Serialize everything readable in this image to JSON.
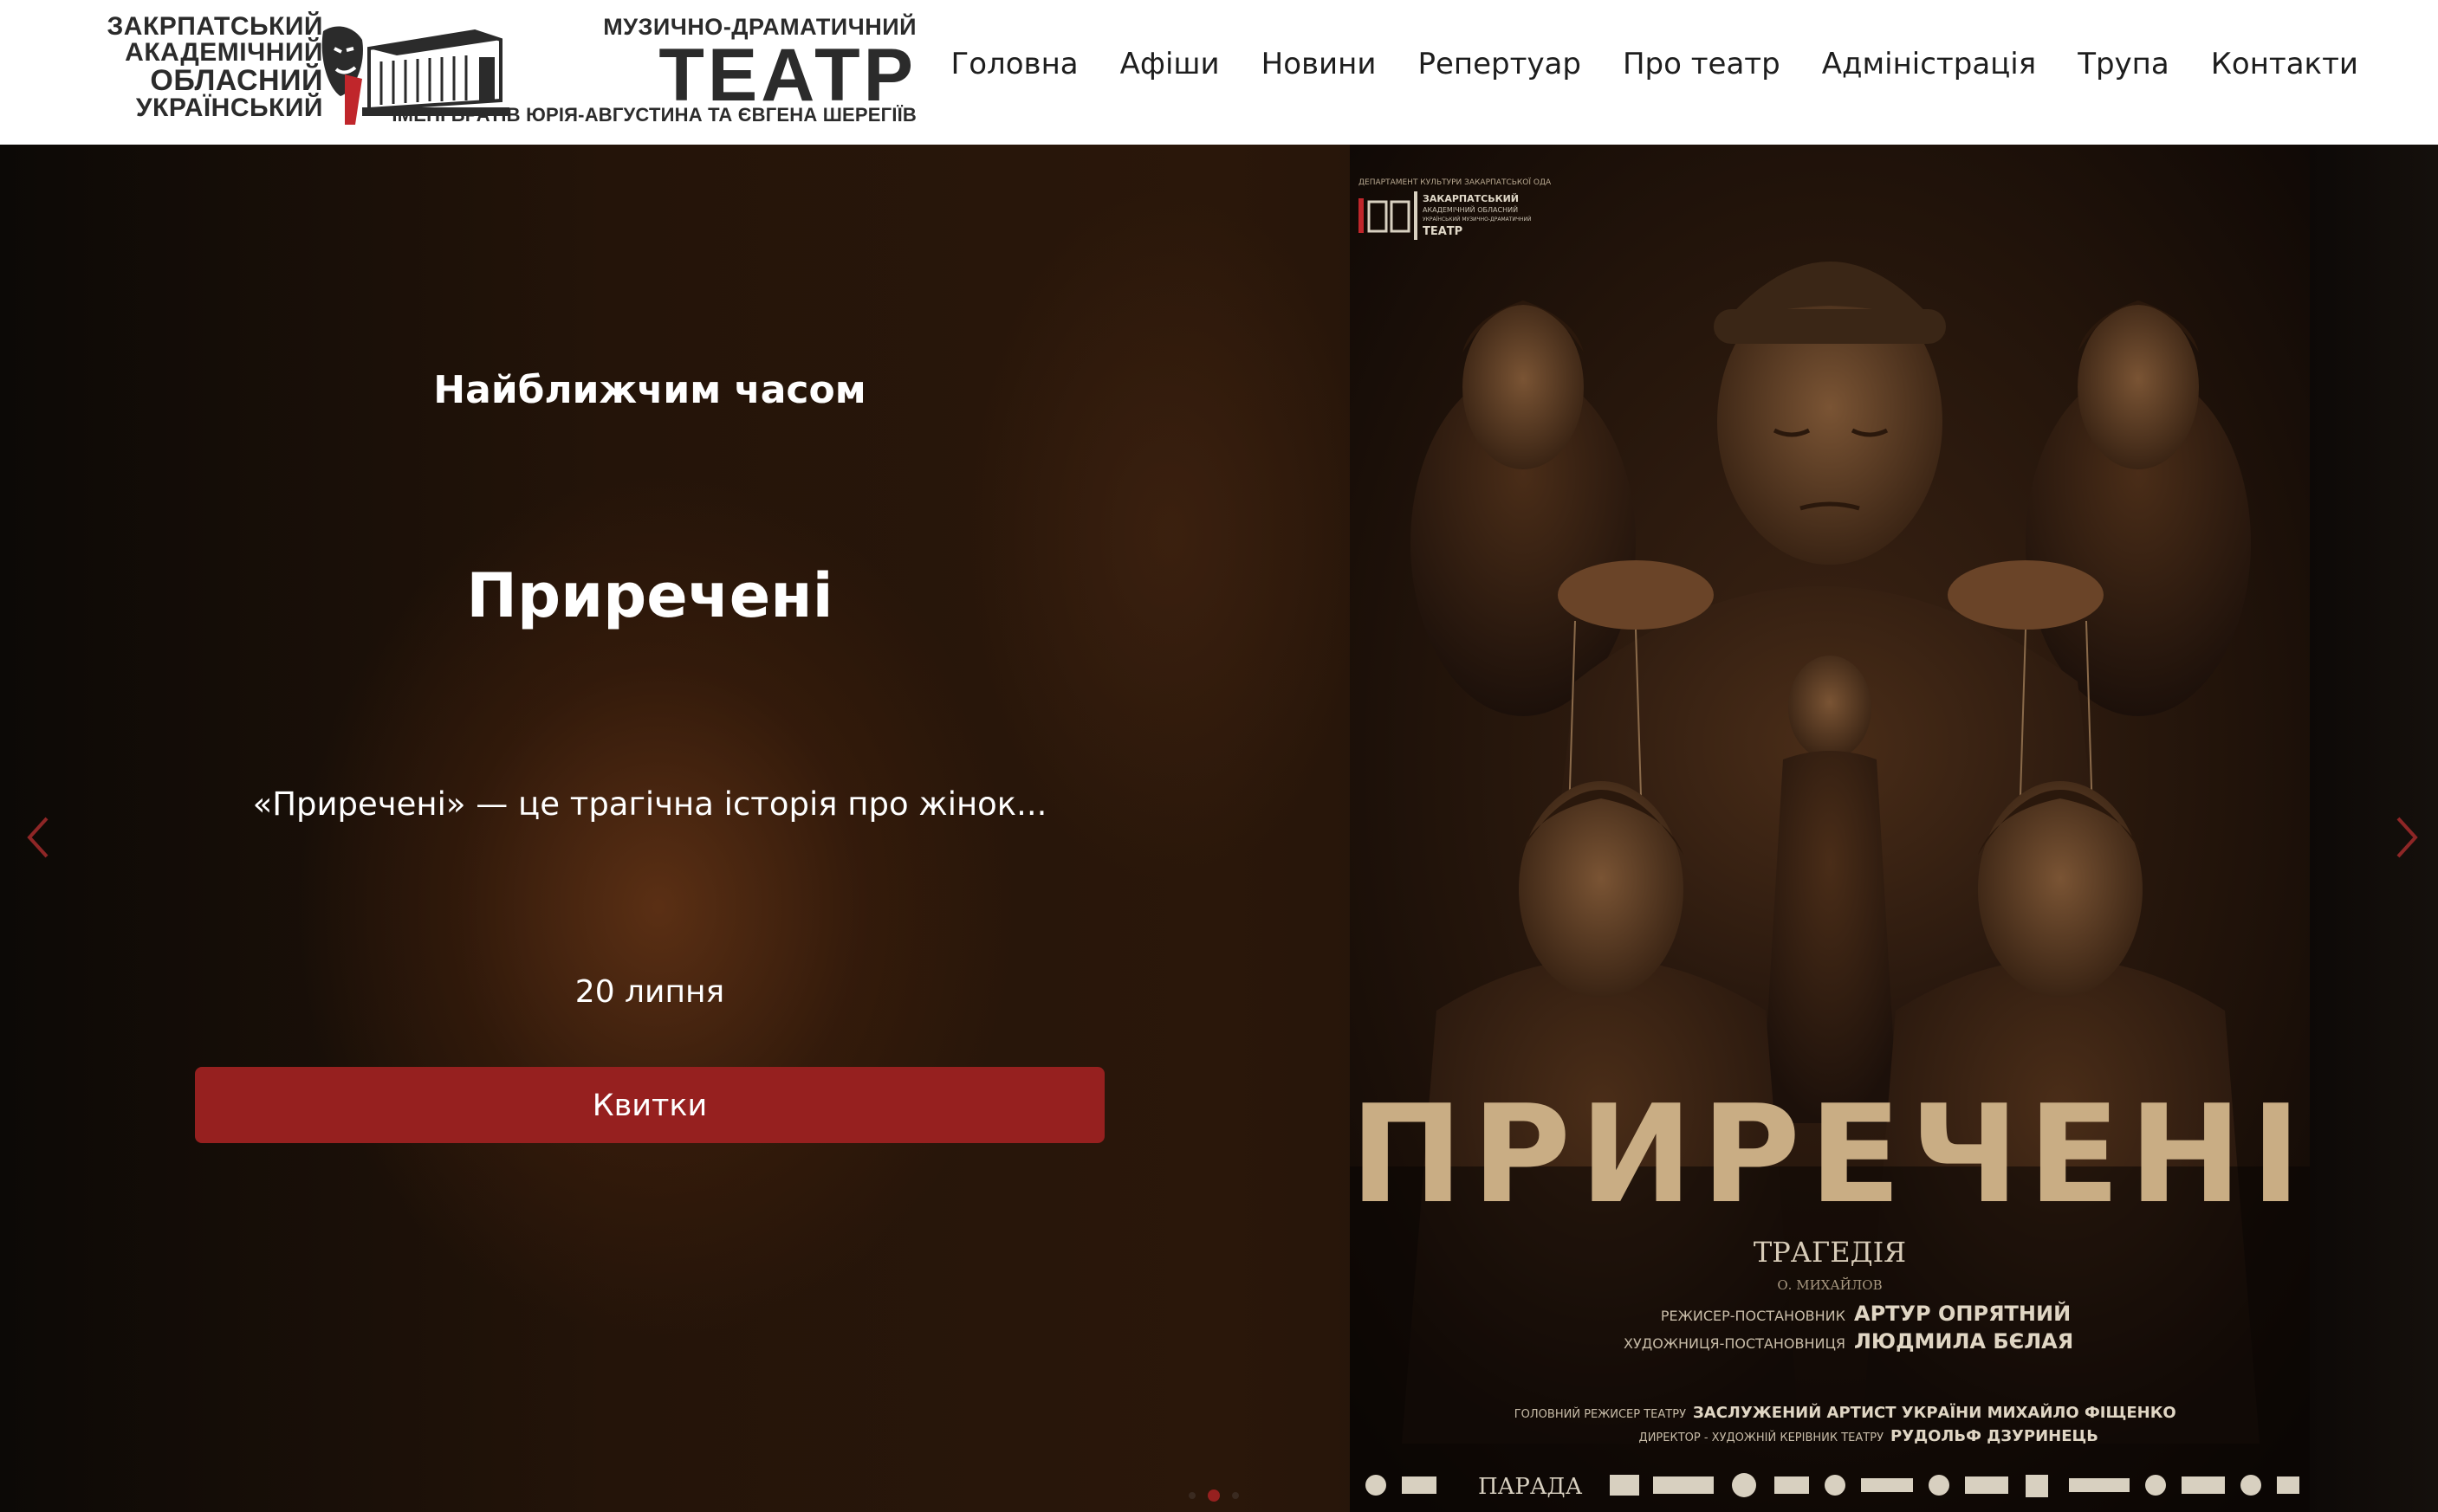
{
  "header": {
    "logo": {
      "left_lines": [
        "ЗАКРПАТСЬКИЙ",
        "АКАДЕМІЧНИЙ",
        "ОБЛАСНИЙ",
        "УКРАЇНСЬКИЙ"
      ],
      "top_line": "МУЗИЧНО-ДРАМАТИЧНИЙ",
      "big_word": "ТЕАТР",
      "bottom_line": "ІМЕНІ БРАТІВ ЮРІЯ-АВГУСТИНА ТА ЄВГЕНА ШЕРЕГІЇВ"
    },
    "nav": [
      {
        "label": "Головна",
        "id": "home"
      },
      {
        "label": "Афіши",
        "id": "posters"
      },
      {
        "label": "Новини",
        "id": "news"
      },
      {
        "label": "Репертуар",
        "id": "repertoire"
      },
      {
        "label": "Про театр",
        "id": "about"
      },
      {
        "label": "Адміністрація",
        "id": "administration"
      },
      {
        "label": "Трупа",
        "id": "troupe"
      },
      {
        "label": "Контакти",
        "id": "contacts"
      }
    ]
  },
  "hero": {
    "subtitle": "Найближчим часом",
    "title": "Приречені",
    "description": "«Приречені» — це трагічна історія про жінок...",
    "date": "20 липня",
    "button_label": "Квитки",
    "accent_color": "#96201f",
    "slider": {
      "total": 3,
      "active": 2
    }
  },
  "poster": {
    "top_text": "ДЕПАРТАМЕНТ КУЛЬТУРИ ЗАКАРПАТСЬКОЇ ОДА",
    "logo_text_lines": [
      "ЗАКАРПАТСЬКИЙ",
      "АКАДЕМІЧНИЙ ОБЛАСНИЙ",
      "УКРАЇНСЬКИЙ МУЗИЧНО-ДРАМАТИЧНИЙ",
      "ТЕАТР"
    ],
    "title": "ПРИРЕЧЕНІ",
    "genre": "ТРАГЕДІЯ",
    "author": "О. МИХАЙЛОВ",
    "credit_director_role": "РЕЖИСЕР-ПОСТАНОВНИК",
    "credit_director_name": "АРТУР ОПРЯТНИЙ",
    "credit_designer_role": "ХУДОЖНИЦЯ-ПОСТАНОВНИЦЯ",
    "credit_designer_name": "ЛЮДМИЛА БЄЛАЯ",
    "credit_chief_role": "ГОЛОВНИЙ РЕЖИСЕР ТЕАТРУ",
    "credit_chief_name": "ЗАСЛУЖЕНИЙ АРТИСТ УКРАЇНИ МИХАЙЛО ФІЩЕНКО",
    "credit_head_role": "ДИРЕКТОР - ХУДОЖНІЙ КЕРІВНИК ТЕАТРУ",
    "credit_head_name": "РУДОЛЬФ ДЗУРИНЕЦЬ",
    "sponsor": "ПАРАДА",
    "title_color": "#c9ad84"
  }
}
